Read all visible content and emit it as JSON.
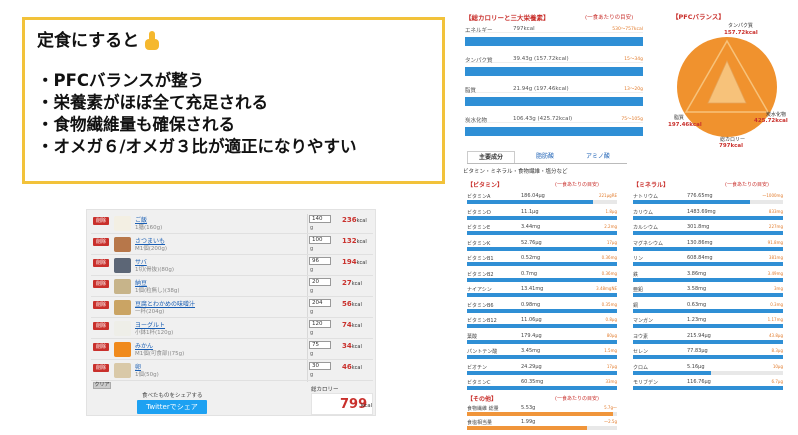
{
  "callout": {
    "title": "定食にすると",
    "points": [
      "・PFCバランスが整う",
      "・栄養素がほぼ全て充足される",
      "・食物繊維量も確保される",
      "・オメガ６/オメガ３比が適正になりやすい"
    ]
  },
  "meal": {
    "delete_label": "削除",
    "items": [
      {
        "name": "ご飯",
        "portion": "1膳(160g)",
        "qty": "140",
        "unit": "g",
        "kcal": "236",
        "kcal_unit": "kcal",
        "color": "#f3efe3"
      },
      {
        "name": "さつまいも",
        "portion": "M1個(200g)",
        "qty": "100",
        "unit": "g",
        "kcal": "132",
        "kcal_unit": "kcal",
        "color": "#b7774a"
      },
      {
        "name": "サバ",
        "portion": "1切(骨抜)(80g)",
        "qty": "96",
        "unit": "g",
        "kcal": "194",
        "kcal_unit": "kcal",
        "color": "#5c6676"
      },
      {
        "name": "納豆",
        "portion": "1個(粒無し)(38g)",
        "qty": "20",
        "unit": "g",
        "kcal": "27",
        "kcal_unit": "kcal",
        "color": "#c7b48a"
      },
      {
        "name": "豆腐とわかめの味噌汁",
        "portion": "一杯(204g)",
        "qty": "204",
        "unit": "g",
        "kcal": "56",
        "kcal_unit": "kcal",
        "color": "#caa464"
      },
      {
        "name": "ヨーグルト",
        "portion": "小鉢1杯(120g)",
        "qty": "120",
        "unit": "g",
        "kcal": "74",
        "kcal_unit": "kcal",
        "color": "#eeeee8"
      },
      {
        "name": "みかん",
        "portion": "M1個(可食部)(75g)",
        "qty": "75",
        "unit": "g",
        "kcal": "34",
        "kcal_unit": "kcal",
        "color": "#f08a1c"
      },
      {
        "name": "卵",
        "portion": "1個(50g)",
        "qty": "30",
        "unit": "g",
        "kcal": "46",
        "kcal_unit": "kcal",
        "color": "#d9c9a8"
      }
    ],
    "clear_label": "クリア",
    "share_label": "食べたものをシェアする",
    "twitter_label": "Twitterでシェア",
    "total_label": "総カロリー",
    "total_value": "799",
    "total_unit": "kcal"
  },
  "macro": {
    "title": "【総カロリーと三大栄養素】",
    "note": "(一食あたりの目安)",
    "rows": [
      {
        "label": "エネルギー",
        "value": "797kcal",
        "target": "530〜757kcal",
        "fill": 1.0
      },
      {
        "label": "タンパク質",
        "value": "39.43g (157.72kcal)",
        "target": "15〜34g",
        "fill": 1.0
      },
      {
        "label": "脂質",
        "value": "21.94g (197.46kcal)",
        "target": "13〜20g",
        "fill": 1.0
      },
      {
        "label": "炭水化物",
        "value": "106.43g (425.72kcal)",
        "target": "75〜105g",
        "fill": 1.0
      }
    ]
  },
  "pfc": {
    "title": "【PFCバランス】",
    "protein_label": "タンパク質",
    "protein_value": "157.72kcal",
    "fat_label": "脂質",
    "fat_value": "197.46kcal",
    "carb_label": "炭水化物",
    "carb_value": "425.72kcal",
    "total_label": "総カロリー",
    "total_value": "797kcal",
    "colors": {
      "outer": "#f0922e",
      "inner": "#f7c27a",
      "label": "#c9302c"
    }
  },
  "micro": {
    "tabs": [
      "主要成分",
      "脂肪酸",
      "アミノ酸"
    ],
    "subtitle": "ビタミン・ミネラル・食物繊維・塩分など",
    "vitamins": {
      "title": "【ビタミン】",
      "note": "(一食あたりの目安)",
      "rows": [
        {
          "label": "ビタミンA",
          "value": "186.04μg",
          "target": "221μgRE",
          "fill": 0.84
        },
        {
          "label": "ビタミンD",
          "value": "11.1μg",
          "target": "1.8μg",
          "fill": 1.0
        },
        {
          "label": "ビタミンE",
          "value": "3.44mg",
          "target": "2.2mg",
          "fill": 1.0
        },
        {
          "label": "ビタミンK",
          "value": "52.76μg",
          "target": "17μg",
          "fill": 1.0
        },
        {
          "label": "ビタミンB1",
          "value": "0.52mg",
          "target": "0.36mg",
          "fill": 1.0
        },
        {
          "label": "ビタミンB2",
          "value": "0.7mg",
          "target": "0.36mg",
          "fill": 1.0
        },
        {
          "label": "ナイアシン",
          "value": "13.41mg",
          "target": "3.48mgNE",
          "fill": 1.0
        },
        {
          "label": "ビタミンB6",
          "value": "0.98mg",
          "target": "0.35mg",
          "fill": 1.0
        },
        {
          "label": "ビタミンB12",
          "value": "11.06μg",
          "target": "0.8μg",
          "fill": 1.0
        },
        {
          "label": "葉酸",
          "value": "179.4μg",
          "target": "80μg",
          "fill": 1.0
        },
        {
          "label": "パントテン酸",
          "value": "3.45mg",
          "target": "1.5mg",
          "fill": 1.0
        },
        {
          "label": "ビオチン",
          "value": "24.29μg",
          "target": "17μg",
          "fill": 1.0
        },
        {
          "label": "ビタミンC",
          "value": "60.35mg",
          "target": "33mg",
          "fill": 1.0
        }
      ]
    },
    "minerals": {
      "title": "【ミネラル】",
      "note": "(一食あたりの目安)",
      "rows": [
        {
          "label": "ナトリウム",
          "value": "776.65mg",
          "target": "〜1000mg",
          "fill": 0.78
        },
        {
          "label": "カリウム",
          "value": "1483.69mg",
          "target": "833mg",
          "fill": 1.0
        },
        {
          "label": "カルシウム",
          "value": "301.8mg",
          "target": "227mg",
          "fill": 1.0
        },
        {
          "label": "マグネシウム",
          "value": "130.86mg",
          "target": "91.8mg",
          "fill": 1.0
        },
        {
          "label": "リン",
          "value": "608.84mg",
          "target": "381mg",
          "fill": 1.0
        },
        {
          "label": "鉄",
          "value": "3.86mg",
          "target": "3.49mg",
          "fill": 1.0
        },
        {
          "label": "亜鉛",
          "value": "3.58mg",
          "target": "3mg",
          "fill": 1.0
        },
        {
          "label": "銅",
          "value": "0.63mg",
          "target": "0.3mg",
          "fill": 1.0
        },
        {
          "label": "マンガン",
          "value": "1.23mg",
          "target": "1.17mg",
          "fill": 1.0
        },
        {
          "label": "ヨウ素",
          "value": "215.94μg",
          "target": "43.8μg",
          "fill": 1.0
        },
        {
          "label": "セレン",
          "value": "77.83μg",
          "target": "8.3μg",
          "fill": 1.0
        },
        {
          "label": "クロム",
          "value": "5.16μg",
          "target": "10μg",
          "fill": 0.52
        },
        {
          "label": "モリブデン",
          "value": "116.76μg",
          "target": "6.7μg",
          "fill": 1.0
        }
      ]
    },
    "other": {
      "title": "【その他】",
      "note": "(一食あたりの目安)",
      "rows": [
        {
          "label": "食物繊維 総量",
          "value": "5.53g",
          "target": "5.7g〜",
          "fill": 0.97,
          "over": true
        },
        {
          "label": "食塩相当量",
          "value": "1.99g",
          "target": "〜2.5g",
          "fill": 0.8,
          "over": true
        }
      ]
    }
  }
}
